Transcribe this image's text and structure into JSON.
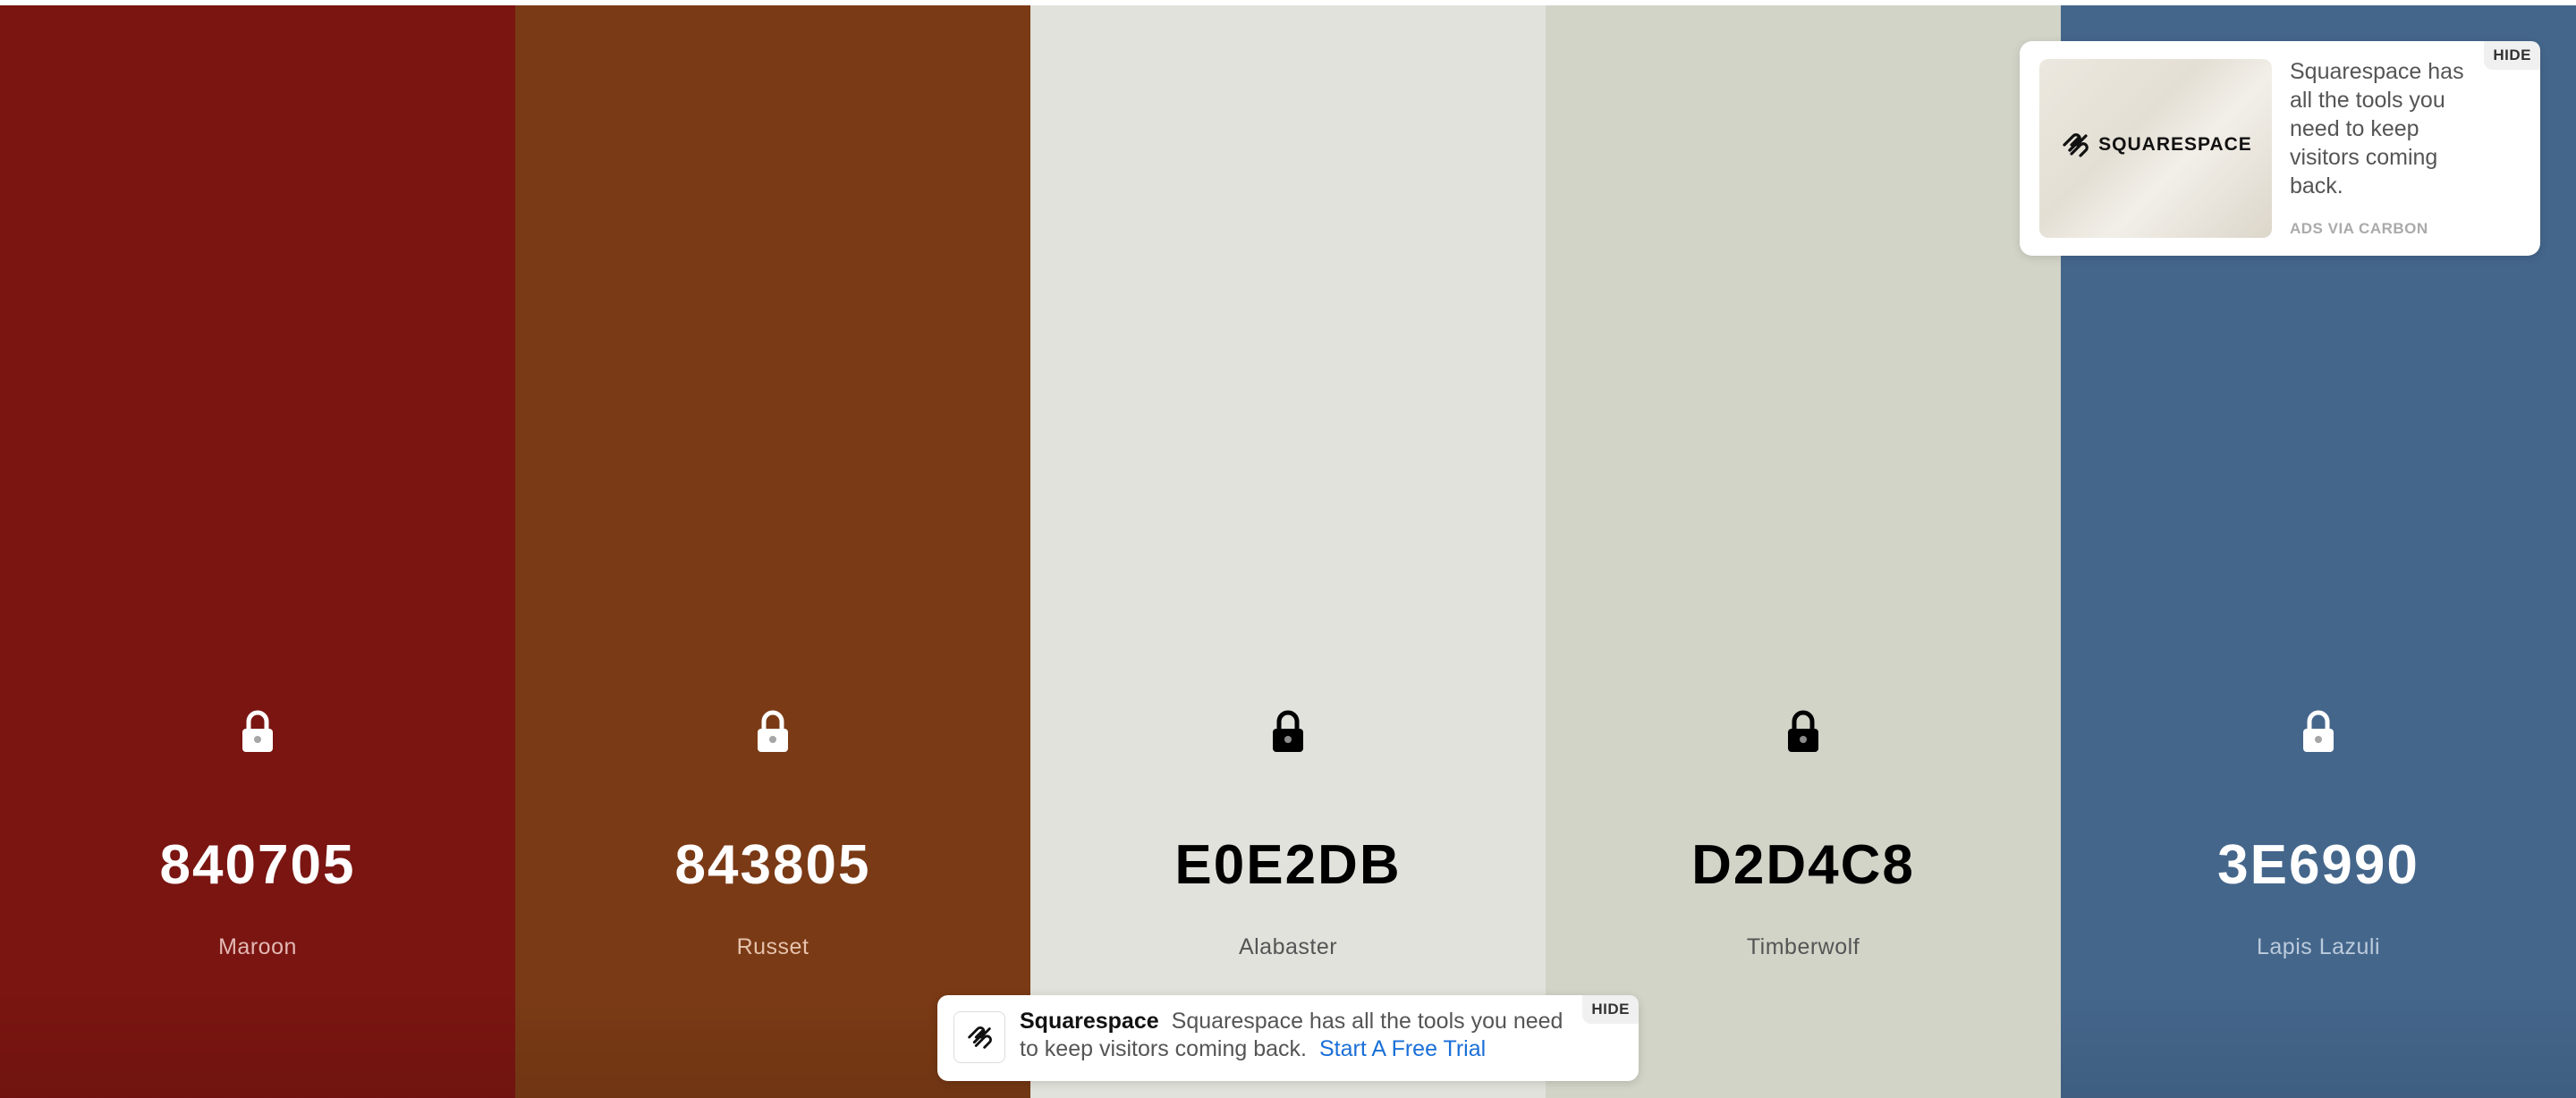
{
  "palette": {
    "swatches": [
      {
        "hex": "840705",
        "name": "Maroon",
        "bg": "#7a1511",
        "hex_color": "#ffffff",
        "name_color": "#e3b8b5",
        "lock_color": "#ffffff"
      },
      {
        "hex": "843805",
        "name": "Russet",
        "bg": "#7a3a15",
        "hex_color": "#ffffff",
        "name_color": "#e6c3ad",
        "lock_color": "#ffffff"
      },
      {
        "hex": "E0E2DB",
        "name": "Alabaster",
        "bg": "#e0e2db",
        "hex_color": "#000000",
        "name_color": "#555555",
        "lock_color": "#000000"
      },
      {
        "hex": "D2D4C8",
        "name": "Timberwolf",
        "bg": "#d2d4c8",
        "hex_color": "#000000",
        "name_color": "#555555",
        "lock_color": "#000000"
      },
      {
        "hex": "3E6990",
        "name": "Lapis Lazuli",
        "bg": "#44668b",
        "hex_color": "#ffffff",
        "name_color": "#bccbdc",
        "lock_color": "#ffffff"
      }
    ]
  },
  "carbon_ad": {
    "brand": "SQUARESPACE",
    "text": "Squarespace has all the tools you need to keep visitors coming back.",
    "via": "ADS VIA CARBON",
    "hide_label": "HIDE"
  },
  "banner_ad": {
    "brand": "Squarespace",
    "text": "Squarespace has all the tools you need to keep visitors coming back.",
    "cta": "Start A Free Trial",
    "hide_label": "HIDE"
  },
  "icons": {
    "lock": "lock-icon",
    "logo": "squarespace-logo-icon"
  }
}
